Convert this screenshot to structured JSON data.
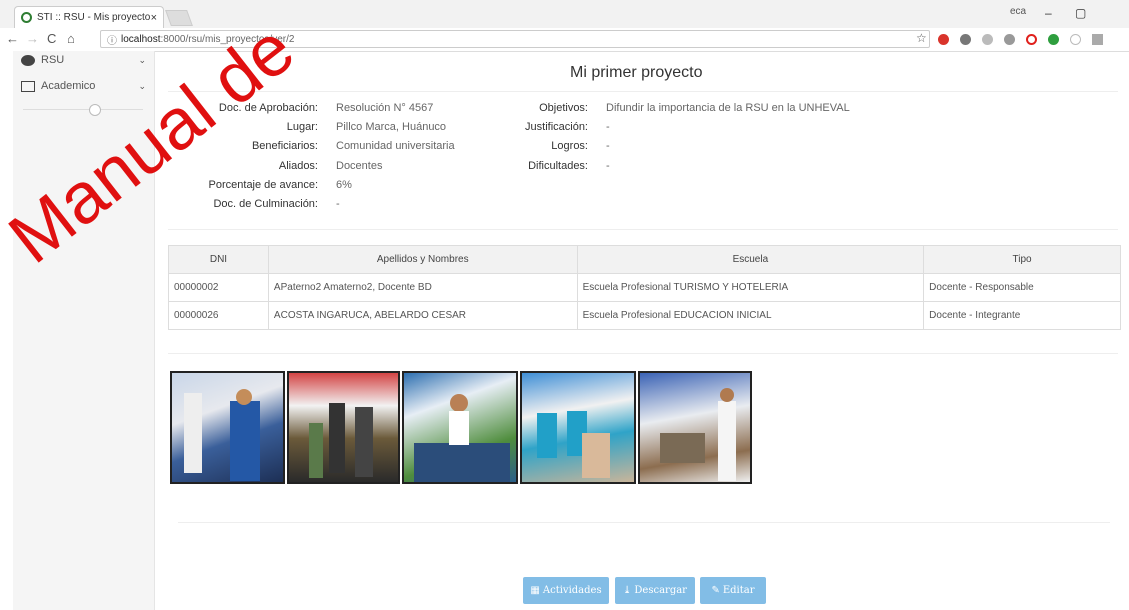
{
  "browser": {
    "tab_title": "STI :: RSU - Mis proyecto",
    "tab_close": "×",
    "url_host": "localhost",
    "url_path": ":8000/rsu/mis_proyectos/ver/2",
    "user_label": "eca",
    "nav_back": "←",
    "nav_forward": "→",
    "nav_reload": "C",
    "nav_home": "⌂",
    "info_icon": "ⓘ",
    "star": "☆"
  },
  "sidebar": {
    "items": [
      {
        "label": "RSU",
        "chevron": "⌄"
      },
      {
        "label": "Academico",
        "chevron": "⌄"
      }
    ]
  },
  "project": {
    "title": "Mi primer proyecto",
    "left_fields": [
      {
        "label": "Doc. de Aprobación:",
        "value": "Resolución N° 4567"
      },
      {
        "label": "Lugar:",
        "value": "Pillco Marca, Huánuco"
      },
      {
        "label": "Beneficiarios:",
        "value": "Comunidad universitaria"
      },
      {
        "label": "Aliados:",
        "value": "Docentes"
      },
      {
        "label": "Porcentaje de avance:",
        "value": "6%"
      },
      {
        "label": "Doc. de Culminación:",
        "value": "-"
      }
    ],
    "right_fields": [
      {
        "label": "Objetivos:",
        "value": "Difundir la importancia de la RSU en la UNHEVAL"
      },
      {
        "label": "Justificación:",
        "value": "-"
      },
      {
        "label": "Logros:",
        "value": "-"
      },
      {
        "label": "Dificultades:",
        "value": "-"
      }
    ]
  },
  "table": {
    "headers": [
      "DNI",
      "Apellidos y Nombres",
      "Escuela",
      "Tipo"
    ],
    "rows": [
      [
        "00000002",
        "APaterno2 Amaterno2, Docente BD",
        "Escuela Profesional TURISMO Y HOTELERIA",
        "Docente - Responsable"
      ],
      [
        "00000026",
        "ACOSTA INGARUCA, ABELARDO CESAR",
        "Escuela Profesional EDUCACION INICIAL",
        "Docente - Integrante"
      ]
    ]
  },
  "buttons": {
    "actividades": "Actividades",
    "descargar": "Descargar",
    "editar": "Editar"
  },
  "watermark": "Manual de"
}
